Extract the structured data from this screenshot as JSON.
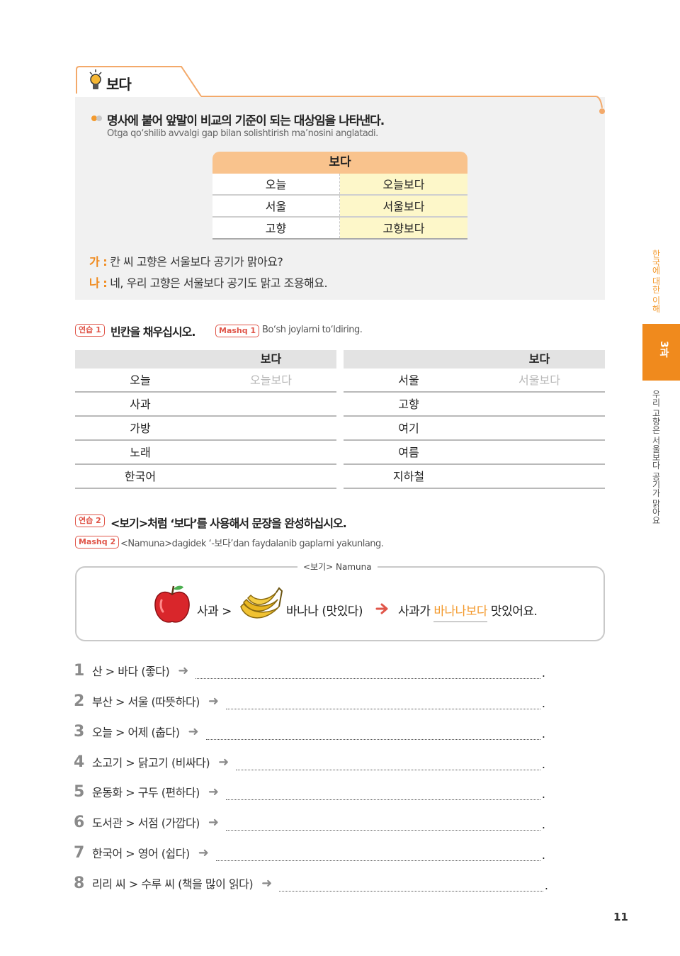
{
  "header": {
    "title": "보다"
  },
  "grammar": {
    "description": "명사에 붙어 앞말이 비교의 기준이 되는 대상임을 나타낸다.",
    "translation": "Otga qo‘shilib avvalgi gap bilan solishtirish ma’nosini anglatadi.",
    "table": {
      "header": "보다",
      "rows": [
        {
          "base": "오늘",
          "result": "오늘보다"
        },
        {
          "base": "서울",
          "result": "서울보다"
        },
        {
          "base": "고향",
          "result": "고향보다"
        }
      ]
    },
    "dialogue": [
      {
        "speaker": "가 :",
        "text": "칸 씨 고향은 서울보다 공기가 맑아요?"
      },
      {
        "speaker": "나 :",
        "text": "네, 우리 고향은 서울보다 공기도 맑고 조용해요."
      }
    ]
  },
  "exercise1": {
    "badge": "연습 1",
    "title": "빈칸을 채우십시오.",
    "badge2": "Mashq 1",
    "translation": "Bo‘sh joylarni to‘ldiring.",
    "left": {
      "header": "보다",
      "rows": [
        {
          "word": "오늘",
          "answer": "오늘보다"
        },
        {
          "word": "사과",
          "answer": ""
        },
        {
          "word": "가방",
          "answer": ""
        },
        {
          "word": "노래",
          "answer": ""
        },
        {
          "word": "한국어",
          "answer": ""
        }
      ]
    },
    "right": {
      "header": "보다",
      "rows": [
        {
          "word": "서울",
          "answer": "서울보다"
        },
        {
          "word": "고향",
          "answer": ""
        },
        {
          "word": "여기",
          "answer": ""
        },
        {
          "word": "여름",
          "answer": ""
        },
        {
          "word": "지하철",
          "answer": ""
        }
      ]
    }
  },
  "exercise2": {
    "badge": "연습 2",
    "title": "<보기>처럼 ‘보다’를 사용해서 문장을 완성하십시오.",
    "badge2": "Mashq 2",
    "translation": "<Namuna>dagidek ‘-보다’dan faydalanib gaplarni yakunlang.",
    "example": {
      "label": "<보기> Namuna",
      "part_a": "사과 >",
      "part_b": "바나나 (맛있다)",
      "answer_prefix": "사과가 ",
      "answer_highlight": "바나나보다",
      "answer_suffix": " 맛있어요."
    },
    "questions": [
      {
        "num": "1",
        "text": "산 > 바다 (좋다)"
      },
      {
        "num": "2",
        "text": "부산 > 서울 (따뜻하다)"
      },
      {
        "num": "3",
        "text": "오늘 > 어제 (춥다)"
      },
      {
        "num": "4",
        "text": "소고기 > 닭고기 (비싸다)"
      },
      {
        "num": "5",
        "text": "운동화 > 구두 (편하다)"
      },
      {
        "num": "6",
        "text": "도서관 > 서점 (가깝다)"
      },
      {
        "num": "7",
        "text": "한국어 > 영어 (쉽다)"
      },
      {
        "num": "8",
        "text": "리리 씨 > 수루 씨 (책을 많이 읽다)"
      }
    ],
    "arrow": "➜",
    "period": "."
  },
  "side": {
    "top": "한국에 대한 이해",
    "tab": "3과",
    "bottom": "우리 고향은 서울보다 공기가 맑아요"
  },
  "page_number": "11",
  "colors": {
    "accent": "#f08a1d",
    "badge": "#e0564a",
    "table_head": "#f9c38d",
    "table_cell": "#fdf7c9"
  }
}
